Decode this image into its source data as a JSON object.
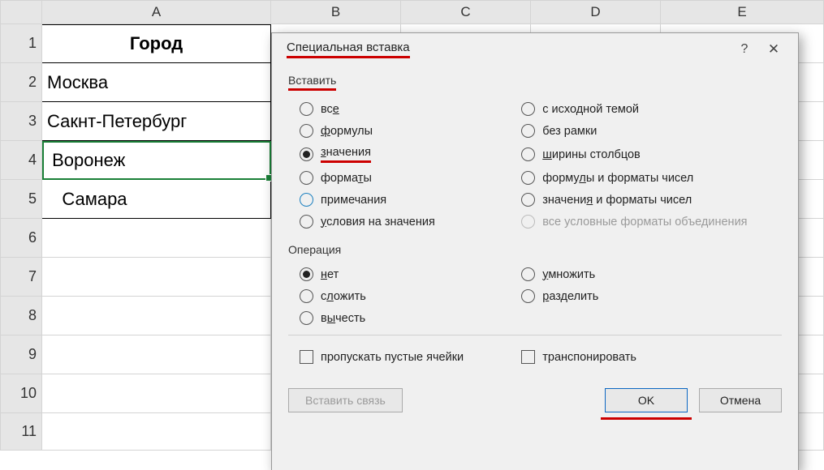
{
  "columns": [
    "A",
    "B",
    "C",
    "D",
    "E"
  ],
  "rows": [
    "1",
    "2",
    "3",
    "4",
    "5",
    "6",
    "7",
    "8",
    "9",
    "10",
    "11"
  ],
  "cells": {
    "A1": "Город",
    "A2": "Москва",
    "A3": "Сакнт-Петербург",
    "A4": " Воронеж",
    "A5": "   Самара"
  },
  "dialog": {
    "title": "Специальная вставка",
    "help": "?",
    "close": "✕",
    "groupPaste": "Вставить",
    "paste": {
      "all": {
        "label": "все",
        "ul": "е"
      },
      "theme": {
        "label": "с исходной темой"
      },
      "formulas": {
        "label": "формулы",
        "ul": "ф"
      },
      "noborder": {
        "label": "без рамки"
      },
      "values": {
        "label": "значения",
        "ul": "з"
      },
      "widths": {
        "label": "ширины столбцов",
        "ul": "ш"
      },
      "formats": {
        "label": "форматы",
        "ul": "т"
      },
      "formnum": {
        "label": "формулы и форматы чисел",
        "ul": "л"
      },
      "notes": {
        "label": "примечания"
      },
      "valnum": {
        "label": "значения и форматы чисел",
        "ul": "я"
      },
      "cond": {
        "label": "условия на значения",
        "ul": "у"
      },
      "condfmt": {
        "label": "все условные форматы объединения"
      }
    },
    "groupOperation": "Операция",
    "op": {
      "none": {
        "label": "нет",
        "ul": "н"
      },
      "mul": {
        "label": "умножить",
        "ul": "у"
      },
      "add": {
        "label": "сложить",
        "ul": "л"
      },
      "div": {
        "label": "разделить",
        "ul": "р"
      },
      "sub": {
        "label": "вычесть",
        "ul": "ы"
      }
    },
    "skipBlanks": "пропускать пустые ячейки",
    "transpose": "транспонировать",
    "pasteLink": "Вставить связь",
    "ok": "OK",
    "cancel": "Отмена"
  }
}
